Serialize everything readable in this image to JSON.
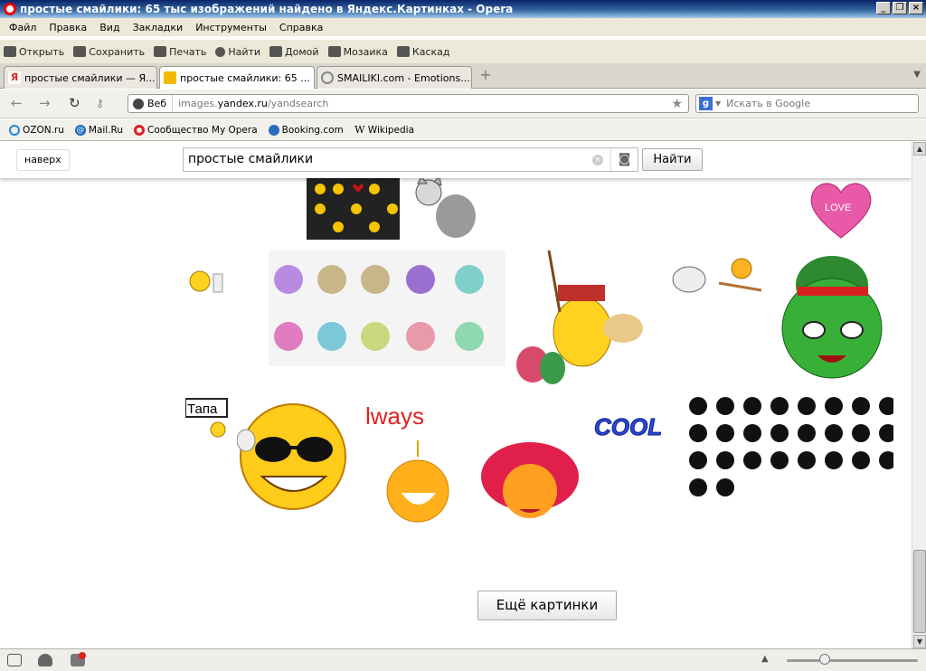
{
  "window": {
    "title": "простые смайлики: 65 тыс изображений найдено в Яндекс.Картинках - Opera"
  },
  "menu": [
    "Файл",
    "Правка",
    "Вид",
    "Закладки",
    "Инструменты",
    "Справка"
  ],
  "toolbar": [
    "Открыть",
    "Сохранить",
    "Печать",
    "Найти",
    "Домой",
    "Мозаика",
    "Каскад"
  ],
  "tabs": [
    {
      "label": "простые смайлики — Я...",
      "active": false,
      "color": "#e02020"
    },
    {
      "label": "простые смайлики: 65 ...",
      "active": true,
      "color": "#f2b800"
    },
    {
      "label": "SMAILIKI.com - Emotions...",
      "active": false,
      "color": "#888888"
    }
  ],
  "address": {
    "web_label": "Веб",
    "url_prefix": "images.",
    "url_host": "yandex.ru",
    "url_path": "/yandsearch"
  },
  "search_engine": {
    "placeholder": "Искать в Google"
  },
  "bookmarks": [
    {
      "label": "OZON.ru",
      "color": "#1e88e5"
    },
    {
      "label": "Mail.Ru",
      "color": "#1565c0"
    },
    {
      "label": "Сообщество My Opera",
      "color": "#e02020"
    },
    {
      "label": "Booking.com",
      "color": "#2a6ebb"
    },
    {
      "label": "Wikipedia",
      "color": "#444444"
    }
  ],
  "page": {
    "top_button": "наверх",
    "query": "простые  смайлики",
    "find_button": "Найти",
    "more_button": "Ещё картинки",
    "image_texts": {
      "sign": "Тапа",
      "always": "lways",
      "cool": "COOL"
    }
  },
  "colors": {
    "title_blue": "#0a246a",
    "accent_yellow": "#ffd21f"
  }
}
